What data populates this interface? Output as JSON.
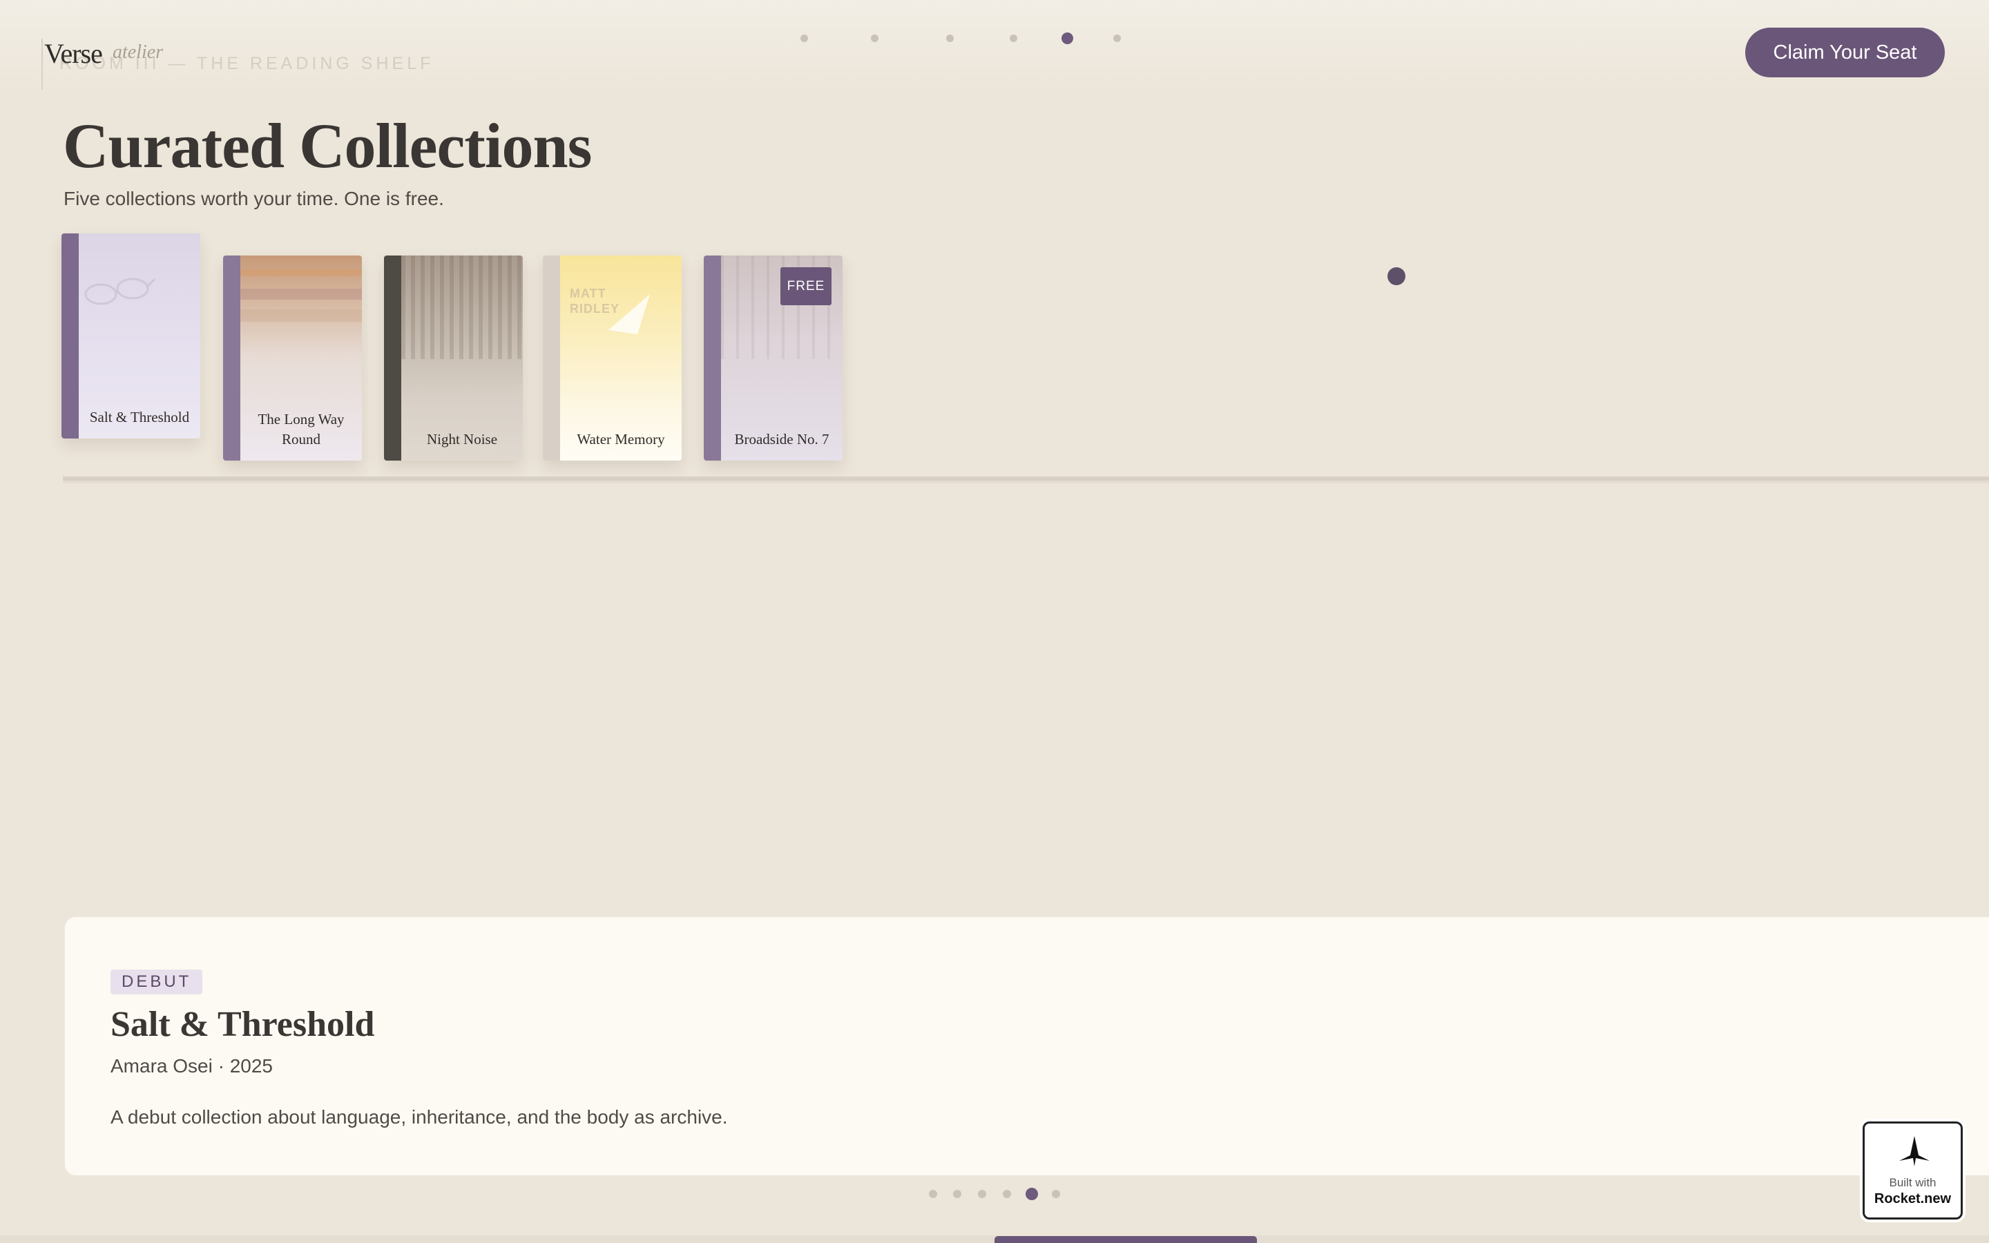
{
  "header": {
    "logo": "Verse",
    "logo_sub": "atelier",
    "room_label": "ROOM III — THE READING SHELF",
    "cta_label": "Claim Your Seat",
    "section_count": 6,
    "active_section": 5
  },
  "page": {
    "title": "Curated Collections",
    "subtitle": "Five collections worth your time. One is free."
  },
  "shelf": {
    "books": [
      {
        "title": "Salt & Threshold",
        "spine_color": "#7d6a8e",
        "cover_color": "#e2dcec",
        "selected": true
      },
      {
        "title": "The Long Way Round",
        "spine_color": "#8a7899",
        "cover_color": "#ece4e0",
        "selected": false
      },
      {
        "title": "Night Noise",
        "spine_color": "#4e4b45",
        "cover_color": "#d7d0c6",
        "selected": false
      },
      {
        "title": "Water Memory",
        "spine_color": "#d8d0c6",
        "cover_color": "#fcf3cf",
        "cover_text": "MATT RIDLEY",
        "selected": false
      },
      {
        "title": "Broadside No. 7",
        "spine_color": "#8a7899",
        "cover_color": "#e6e0ea",
        "badge": "FREE",
        "selected": false
      }
    ]
  },
  "detail": {
    "tag": "DEBUT",
    "title": "Salt & Threshold",
    "meta": "Amara Osei · 2025",
    "description": "A debut collection about language, inheritance, and the body as archive."
  },
  "pager": {
    "count": 6,
    "active_index": 5
  },
  "scroll_progress": 0.55,
  "badge": {
    "small": "Built with",
    "big": "Rocket.new"
  },
  "colors": {
    "accent": "#6a5678",
    "background": "#ece5d9",
    "card": "#fdfaf3",
    "text": "#3a3633"
  }
}
